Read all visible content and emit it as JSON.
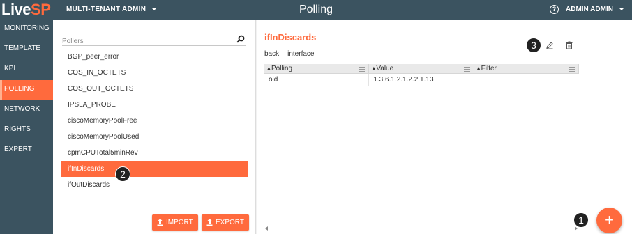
{
  "header": {
    "logo_part1": "Live",
    "logo_part2": "SP",
    "tenant": "MULTI-TENANT ADMIN",
    "page_title": "Polling",
    "help": "?",
    "user": "ADMIN ADMIN"
  },
  "sidebar": {
    "items": [
      {
        "label": "MONITORING"
      },
      {
        "label": "TEMPLATE"
      },
      {
        "label": "KPI"
      },
      {
        "label": "POLLING"
      },
      {
        "label": "NETWORK"
      },
      {
        "label": "RIGHTS"
      },
      {
        "label": "EXPERT"
      }
    ]
  },
  "pollers": {
    "search_placeholder": "Pollers",
    "items": [
      {
        "label": "BGP_peer_error"
      },
      {
        "label": "COS_IN_OCTETS"
      },
      {
        "label": "COS_OUT_OCTETS"
      },
      {
        "label": "IPSLA_PROBE"
      },
      {
        "label": "ciscoMemoryPoolFree"
      },
      {
        "label": "ciscoMemoryPoolUsed"
      },
      {
        "label": "cpmCPUTotal5minRev"
      },
      {
        "label": "ifInDiscards"
      },
      {
        "label": "ifOutDiscards"
      }
    ],
    "import_label": "IMPORT",
    "export_label": "EXPORT"
  },
  "detail": {
    "title": "ifInDiscards",
    "link_back": "back",
    "link_interface": "interface",
    "columns": [
      {
        "label": "Polling"
      },
      {
        "label": "Value"
      },
      {
        "label": "Filter"
      }
    ],
    "rows": [
      {
        "polling": "oid",
        "value": "1.3.6.1.2.1.2.2.1.13",
        "filter": ""
      }
    ],
    "fab_label": "+"
  },
  "annotations": {
    "badge1": "1",
    "badge2": "2",
    "badge3": "3"
  },
  "colors": {
    "accent": "#ff6a3d",
    "nav_bg": "#3b5360"
  }
}
